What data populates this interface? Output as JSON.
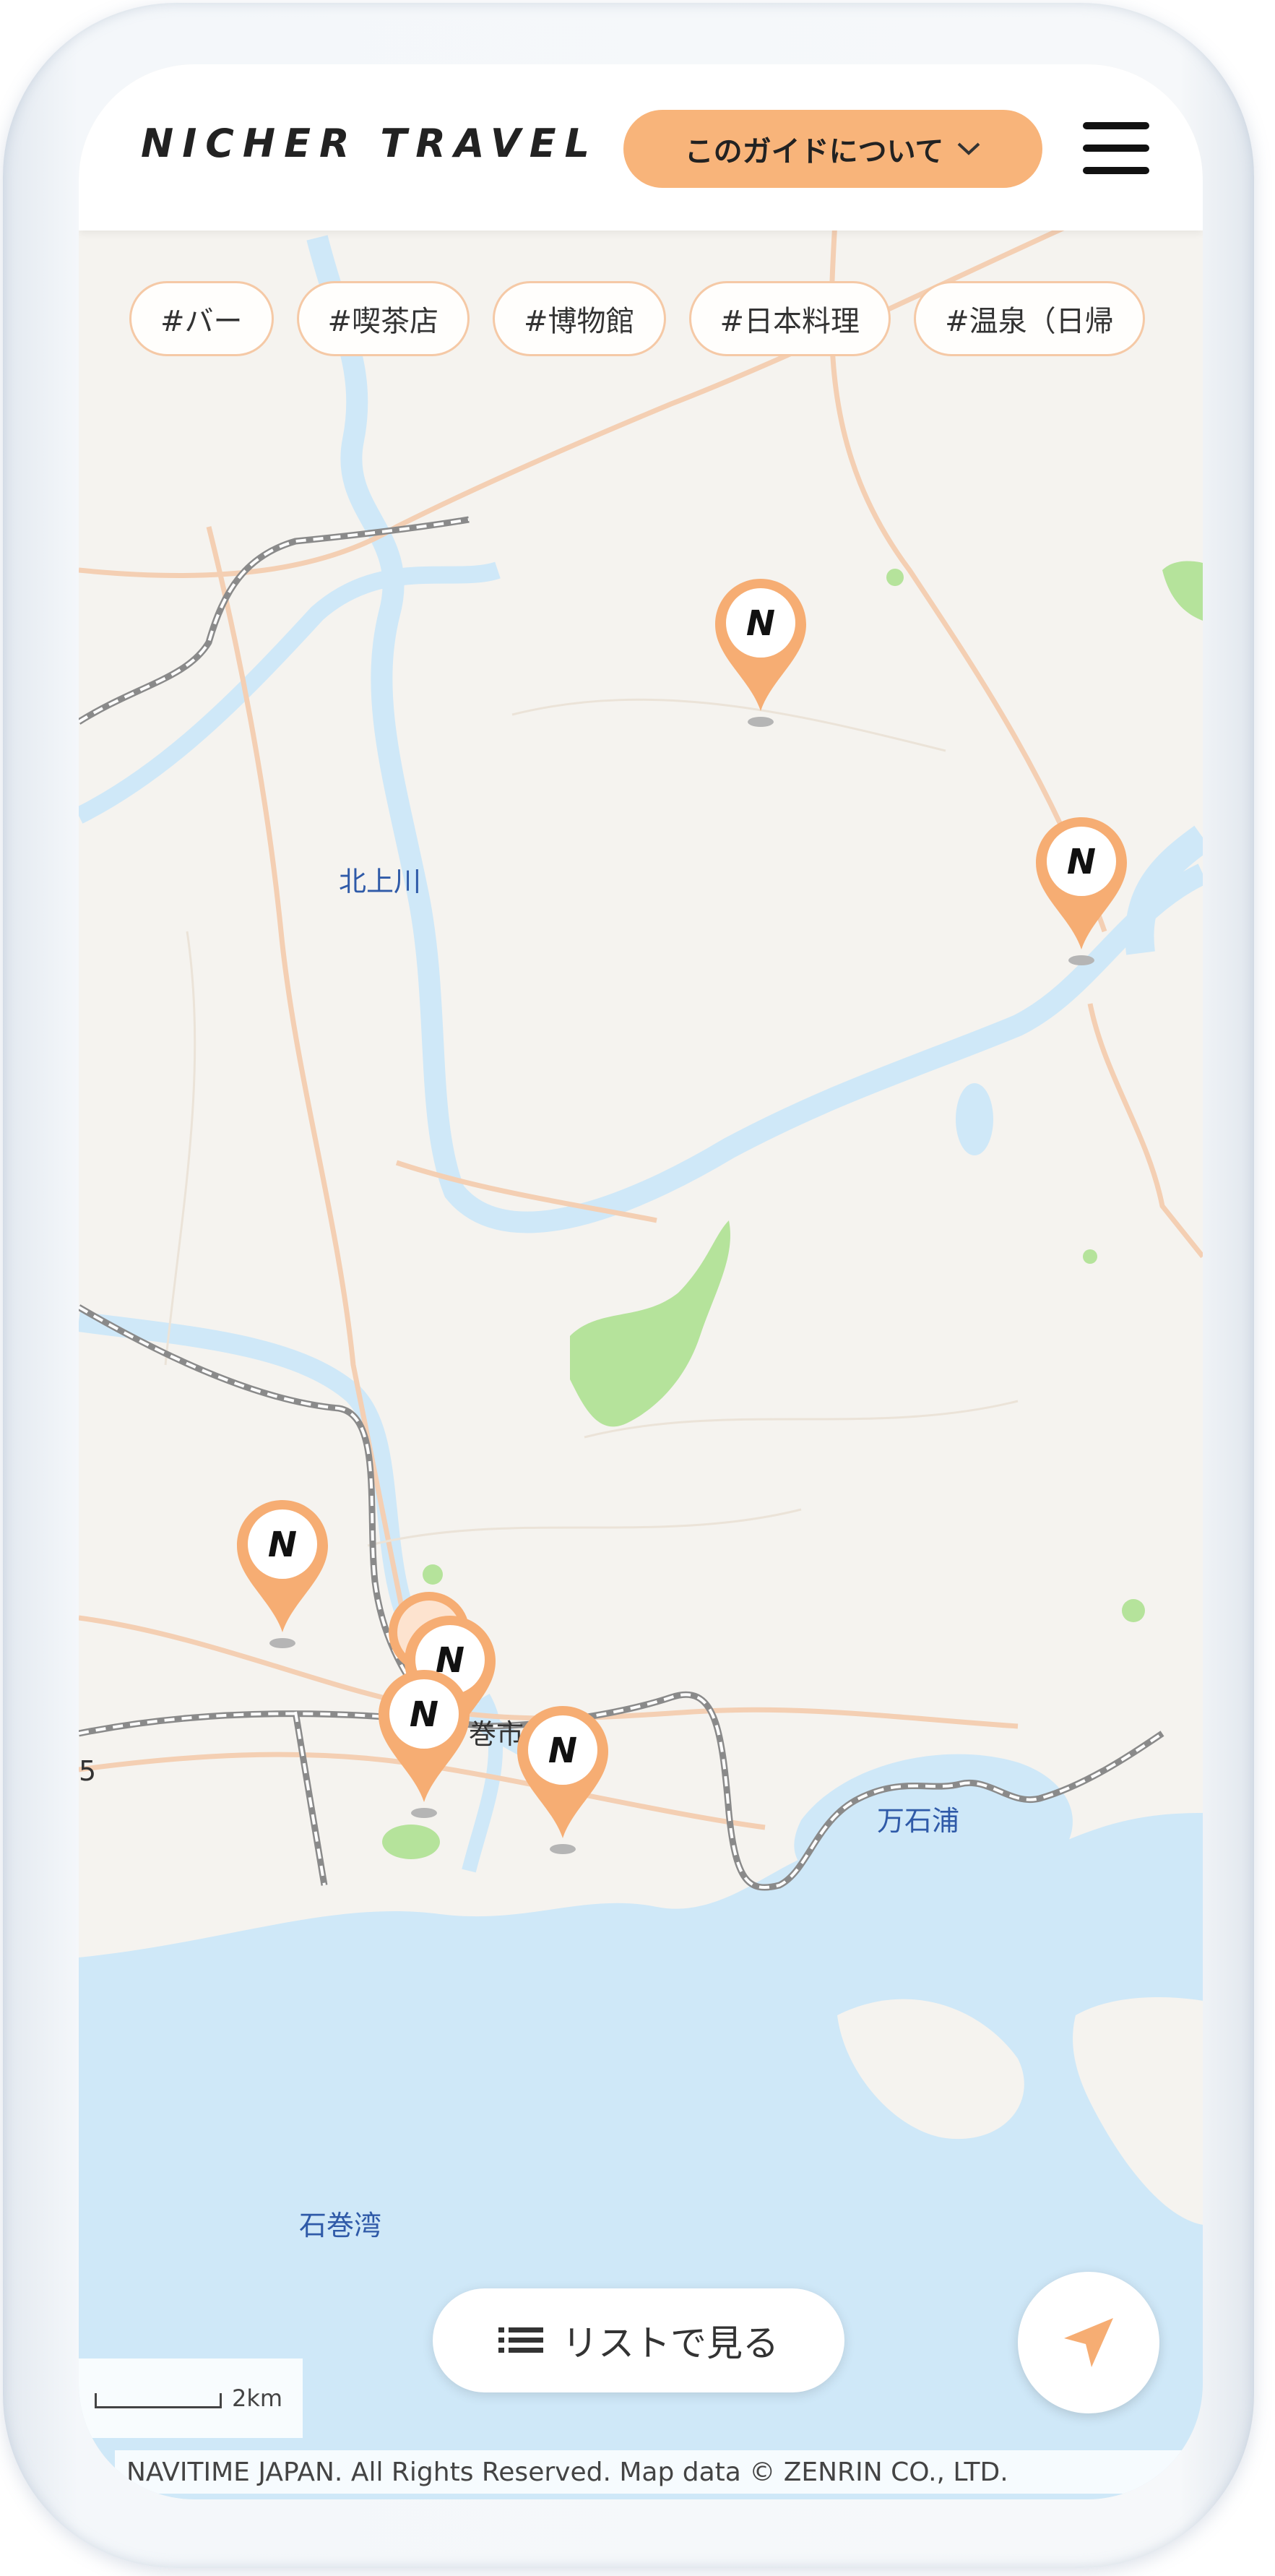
{
  "header": {
    "logo": "NICHER TRAVEL",
    "guide_button_label": "このガイドについて",
    "menu_icon": "hamburger-menu-icon"
  },
  "tags": [
    "#バー",
    "#喫茶店",
    "#博物館",
    "#日本料理",
    "#温泉（日帰"
  ],
  "map_labels": {
    "river": "北上川",
    "bay_east": "万石浦",
    "bay_south": "石巻湾",
    "city": "巻市",
    "edge": "5"
  },
  "pins": [
    {
      "icon": "nicher-pin-icon",
      "letter": "N"
    },
    {
      "icon": "nicher-pin-icon",
      "letter": "N"
    },
    {
      "icon": "nicher-pin-icon",
      "letter": "N"
    },
    {
      "icon": "nicher-pin-icon",
      "letter": "N"
    },
    {
      "icon": "nicher-pin-icon",
      "letter": "N"
    },
    {
      "icon": "nicher-pin-icon",
      "letter": "N"
    }
  ],
  "list_button_label": "リストで見る",
  "scale_label": "2km",
  "copyright": "NAVITIME JAPAN. All Rights Reserved. Map data © ZENRIN CO., LTD.",
  "colors": {
    "accent": "#f8b47a",
    "pin": "#f6ad73",
    "water": "#cfe8f8",
    "land": "#f5f3ef",
    "road": "#f4cfb3"
  }
}
